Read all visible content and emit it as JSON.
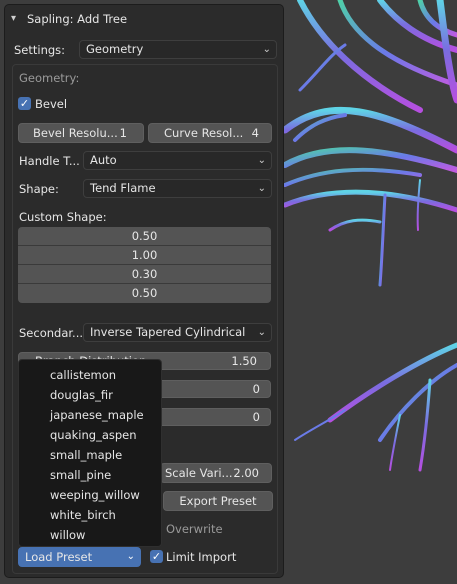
{
  "colors": {
    "accent": "#4772b3",
    "panel": "#2b2b2b",
    "viewport": "#3d3d3d",
    "field": "#545454",
    "menu": "#181818"
  },
  "header": {
    "title": "Sapling: Add Tree",
    "collapse_icon": "chevron-down-icon"
  },
  "settings": {
    "label": "Settings:",
    "value": "Geometry"
  },
  "geometry": {
    "heading": "Geometry:",
    "bevel": {
      "label": "Bevel",
      "checked": true
    },
    "bevel_resolution": {
      "label": "Bevel Resolu...",
      "value": "1"
    },
    "curve_resolution": {
      "label": "Curve Resol...",
      "value": "4"
    },
    "handle_type": {
      "label": "Handle T...",
      "value": "Auto"
    },
    "shape": {
      "label": "Shape:",
      "value": "Tend Flame"
    },
    "custom_shape": {
      "label": "Custom Shape:",
      "values": [
        "0.50",
        "1.00",
        "0.30",
        "0.50"
      ]
    },
    "secondary": {
      "label": "Secondar...",
      "value": "Inverse Tapered Cylindrical"
    },
    "branch_distribution": {
      "label": "Branch Distribution",
      "value": "1.50"
    },
    "field_a_value": "0",
    "field_b_value": "0",
    "scale_variation": {
      "label": "Scale Vari...",
      "value": "2.00"
    }
  },
  "presets": {
    "export_label": "Export Preset",
    "overwrite_label": "Overwrite",
    "load_label": "Load Preset",
    "limit_import": {
      "label": "Limit Import",
      "checked": true
    },
    "menu_items": [
      "callistemon",
      "douglas_fir",
      "japanese_maple",
      "quaking_aspen",
      "small_maple",
      "small_pine",
      "weeping_willow",
      "white_birch",
      "willow"
    ]
  }
}
